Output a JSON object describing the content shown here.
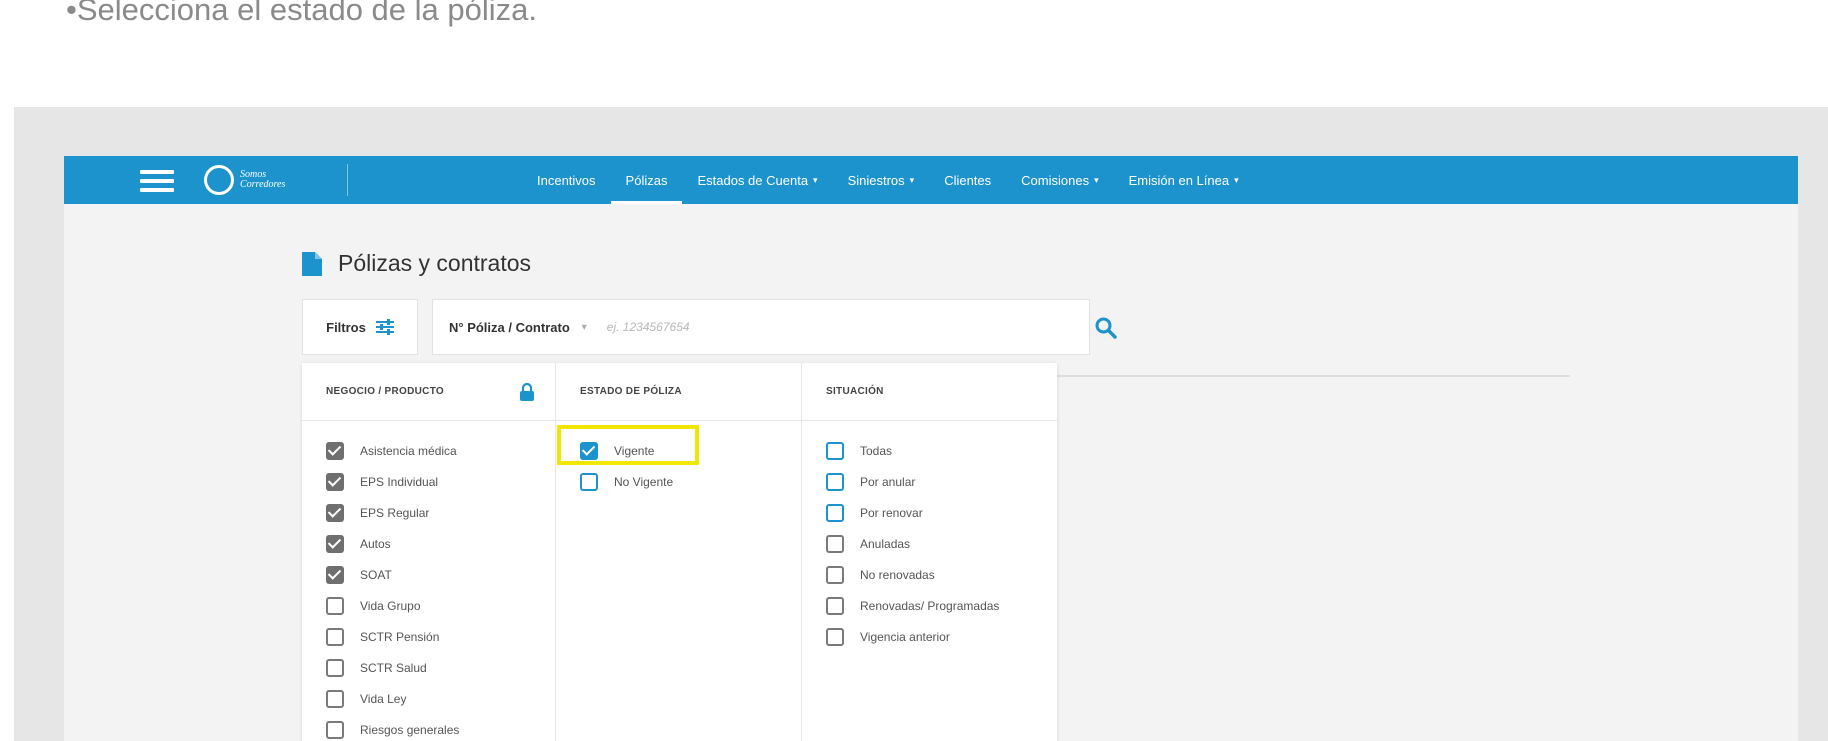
{
  "instruction": {
    "bullet": "•",
    "text": "Selecciona el estado de la póliza."
  },
  "navbar": {
    "logo_line1": "Somos",
    "logo_line2": "Corredores",
    "items": [
      {
        "label": "Incentivos",
        "caret": ""
      },
      {
        "label": "Pólizas",
        "caret": ""
      },
      {
        "label": "Estados de Cuenta",
        "caret": "▾"
      },
      {
        "label": "Siniestros",
        "caret": "▾"
      },
      {
        "label": "Clientes",
        "caret": ""
      },
      {
        "label": "Comisiones",
        "caret": "▾"
      },
      {
        "label": "Emisión en Línea",
        "caret": "▾"
      }
    ],
    "active_item": "Pólizas"
  },
  "page": {
    "title": "Pólizas y contratos"
  },
  "toolbar": {
    "filters_label": "Filtros",
    "search_type": "N° Póliza / Contrato",
    "search_type_caret": "▾",
    "search_placeholder": "ej. 1234567654",
    "search_value": ""
  },
  "filters": {
    "negocio": {
      "header": "NEGOCIO / PRODUCTO",
      "items": [
        {
          "label": "Asistencia médica",
          "checked": true
        },
        {
          "label": "EPS Individual",
          "checked": true
        },
        {
          "label": "EPS Regular",
          "checked": true
        },
        {
          "label": "Autos",
          "checked": true
        },
        {
          "label": "SOAT",
          "checked": true
        },
        {
          "label": "Vida Grupo",
          "checked": false
        },
        {
          "label": "SCTR Pensión",
          "checked": false
        },
        {
          "label": "SCTR Salud",
          "checked": false
        },
        {
          "label": "Vida Ley",
          "checked": false
        },
        {
          "label": "Riesgos generales",
          "checked": false
        }
      ]
    },
    "estado": {
      "header": "ESTADO DE PÓLIZA",
      "items": [
        {
          "label": "Vigente",
          "checked": true
        },
        {
          "label": "No Vigente",
          "checked": false
        }
      ]
    },
    "situacion": {
      "header": "SITUACIÓN",
      "items": [
        {
          "label": "Todas",
          "checked": false
        },
        {
          "label": "Por anular",
          "checked": false
        },
        {
          "label": "Por renovar",
          "checked": false
        },
        {
          "label": "Anuladas",
          "checked": false
        },
        {
          "label": "No renovadas",
          "checked": false
        },
        {
          "label": "Renovadas/ Programadas",
          "checked": false
        },
        {
          "label": "Vigencia anterior",
          "checked": false
        }
      ]
    }
  },
  "colors": {
    "brand_blue": "#1c93cc",
    "highlight_yellow": "#f0e600",
    "bullet_green": "#2aa84a"
  }
}
